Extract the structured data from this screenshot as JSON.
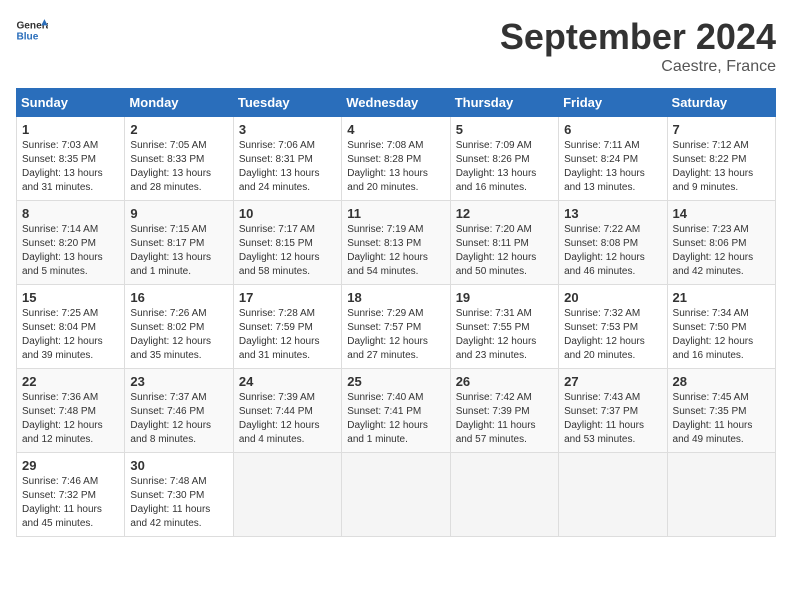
{
  "header": {
    "logo_general": "General",
    "logo_blue": "Blue",
    "month_year": "September 2024",
    "location": "Caestre, France"
  },
  "weekdays": [
    "Sunday",
    "Monday",
    "Tuesday",
    "Wednesday",
    "Thursday",
    "Friday",
    "Saturday"
  ],
  "weeks": [
    [
      {
        "day": "1",
        "sunrise": "7:03 AM",
        "sunset": "8:35 PM",
        "daylight": "13 hours and 31 minutes."
      },
      {
        "day": "2",
        "sunrise": "7:05 AM",
        "sunset": "8:33 PM",
        "daylight": "13 hours and 28 minutes."
      },
      {
        "day": "3",
        "sunrise": "7:06 AM",
        "sunset": "8:31 PM",
        "daylight": "13 hours and 24 minutes."
      },
      {
        "day": "4",
        "sunrise": "7:08 AM",
        "sunset": "8:28 PM",
        "daylight": "13 hours and 20 minutes."
      },
      {
        "day": "5",
        "sunrise": "7:09 AM",
        "sunset": "8:26 PM",
        "daylight": "13 hours and 16 minutes."
      },
      {
        "day": "6",
        "sunrise": "7:11 AM",
        "sunset": "8:24 PM",
        "daylight": "13 hours and 13 minutes."
      },
      {
        "day": "7",
        "sunrise": "7:12 AM",
        "sunset": "8:22 PM",
        "daylight": "13 hours and 9 minutes."
      }
    ],
    [
      {
        "day": "8",
        "sunrise": "7:14 AM",
        "sunset": "8:20 PM",
        "daylight": "13 hours and 5 minutes."
      },
      {
        "day": "9",
        "sunrise": "7:15 AM",
        "sunset": "8:17 PM",
        "daylight": "13 hours and 1 minute."
      },
      {
        "day": "10",
        "sunrise": "7:17 AM",
        "sunset": "8:15 PM",
        "daylight": "12 hours and 58 minutes."
      },
      {
        "day": "11",
        "sunrise": "7:19 AM",
        "sunset": "8:13 PM",
        "daylight": "12 hours and 54 minutes."
      },
      {
        "day": "12",
        "sunrise": "7:20 AM",
        "sunset": "8:11 PM",
        "daylight": "12 hours and 50 minutes."
      },
      {
        "day": "13",
        "sunrise": "7:22 AM",
        "sunset": "8:08 PM",
        "daylight": "12 hours and 46 minutes."
      },
      {
        "day": "14",
        "sunrise": "7:23 AM",
        "sunset": "8:06 PM",
        "daylight": "12 hours and 42 minutes."
      }
    ],
    [
      {
        "day": "15",
        "sunrise": "7:25 AM",
        "sunset": "8:04 PM",
        "daylight": "12 hours and 39 minutes."
      },
      {
        "day": "16",
        "sunrise": "7:26 AM",
        "sunset": "8:02 PM",
        "daylight": "12 hours and 35 minutes."
      },
      {
        "day": "17",
        "sunrise": "7:28 AM",
        "sunset": "7:59 PM",
        "daylight": "12 hours and 31 minutes."
      },
      {
        "day": "18",
        "sunrise": "7:29 AM",
        "sunset": "7:57 PM",
        "daylight": "12 hours and 27 minutes."
      },
      {
        "day": "19",
        "sunrise": "7:31 AM",
        "sunset": "7:55 PM",
        "daylight": "12 hours and 23 minutes."
      },
      {
        "day": "20",
        "sunrise": "7:32 AM",
        "sunset": "7:53 PM",
        "daylight": "12 hours and 20 minutes."
      },
      {
        "day": "21",
        "sunrise": "7:34 AM",
        "sunset": "7:50 PM",
        "daylight": "12 hours and 16 minutes."
      }
    ],
    [
      {
        "day": "22",
        "sunrise": "7:36 AM",
        "sunset": "7:48 PM",
        "daylight": "12 hours and 12 minutes."
      },
      {
        "day": "23",
        "sunrise": "7:37 AM",
        "sunset": "7:46 PM",
        "daylight": "12 hours and 8 minutes."
      },
      {
        "day": "24",
        "sunrise": "7:39 AM",
        "sunset": "7:44 PM",
        "daylight": "12 hours and 4 minutes."
      },
      {
        "day": "25",
        "sunrise": "7:40 AM",
        "sunset": "7:41 PM",
        "daylight": "12 hours and 1 minute."
      },
      {
        "day": "26",
        "sunrise": "7:42 AM",
        "sunset": "7:39 PM",
        "daylight": "11 hours and 57 minutes."
      },
      {
        "day": "27",
        "sunrise": "7:43 AM",
        "sunset": "7:37 PM",
        "daylight": "11 hours and 53 minutes."
      },
      {
        "day": "28",
        "sunrise": "7:45 AM",
        "sunset": "7:35 PM",
        "daylight": "11 hours and 49 minutes."
      }
    ],
    [
      {
        "day": "29",
        "sunrise": "7:46 AM",
        "sunset": "7:32 PM",
        "daylight": "11 hours and 45 minutes."
      },
      {
        "day": "30",
        "sunrise": "7:48 AM",
        "sunset": "7:30 PM",
        "daylight": "11 hours and 42 minutes."
      },
      null,
      null,
      null,
      null,
      null
    ]
  ]
}
